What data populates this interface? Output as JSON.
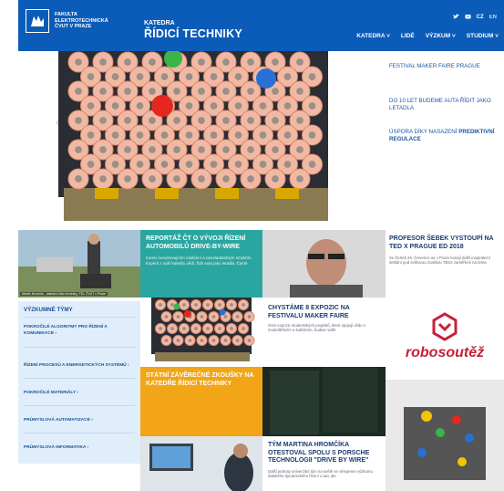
{
  "header": {
    "faculty_lines": [
      "FAKULTA",
      "ELEKTROTECHNICKÁ",
      "ČVUT V PRAZE"
    ],
    "dept_small": "KATEDRA",
    "dept_big": "ŘÍDICÍ TECHNIKY",
    "lang_cz": "CZ",
    "lang_en": "EN",
    "nav": [
      "KATEDRA",
      "LIDÉ",
      "VÝZKUM",
      "STUDIUM"
    ]
  },
  "news": [
    {
      "text": "FESTIVAL MAKER FAIRE PRAGUE"
    },
    {
      "text": "DO 10 LET BUDEME AUTA ŘÍDIT JAKO LETADLA"
    },
    {
      "text_a": "ÚSPORA DÍKY NASAZENÍ ",
      "text_b": "PREDIKTIVNÍ",
      "text_c": "REGULACE"
    }
  ],
  "tiles": {
    "photo_caption": "Martin Hromčík - katedra řídicí techniky, FEL ČVUT v Praze",
    "reportaz_title": "REPORTÁŽ ČT O VÝVOJI ŘÍZENÍ AUTOMOBILŮ DRIVE-BY-WIRE",
    "reportaz_text": "Konec nevyhovujícím zatáčení a neovladatelným smykům. Experti z naší katedry vědí, řídit auta jako letadla. Čtvrté",
    "sebek_title": "PROFESOR ŠEBEK VYSTOUPÍ NA TED X PRAGUE ED 2018",
    "sebek_text": "Ve čtvrtek 26. července se v Praze konají další inspirativní setkání pod světovou značkou TEDx zaměřené na téma",
    "expo_title": "CHYSTÁME 8 EXPOZIC NA FESTIVALU MAKER FAIRE",
    "expo_text": "Osm expozic studentských projektů, které spojují vědu s modelářstvím a kutilstvím, budete vidět",
    "robo": "robosoutěž",
    "szz_title": "STÁTNÍ ZÁVĚREČNÉ ZKOUŠKY NA KATEDŘE ŘÍDICÍ TECHNIKY",
    "tym_title": "TÝM MARTINA HROMČÍKA OTESTOVAL SPOLU S PORSCHE TECHNOLOGII \"DRIVE BY WIRE\"",
    "tym_text": "Další jednoty univerzitní tým na světě se věnujeme výzkumu dalekého dynamického řízení u aut, ale"
  },
  "teams": {
    "heading": "VÝZKUMNÉ TÝMY",
    "items": [
      "POKROČILÉ ALGORITMY PRO ŘÍZENÍ A KOMUNIKACE",
      "ŘÍZENÍ PROCESŮ A ENERGETICKÝCH SYSTÉMŮ",
      "POKROČILÉ MATERIÁLY",
      "PRŮMYSLOVÁ AUTOMATIZACE",
      "PRŮMYSLOVÁ INFORMATIKA"
    ]
  },
  "colors": {
    "brand_blue": "#0b5cb8",
    "teal": "#2aa6a0",
    "orange": "#f2a516",
    "light_blue": "#dfeefa",
    "robo_red": "#c8203a"
  }
}
